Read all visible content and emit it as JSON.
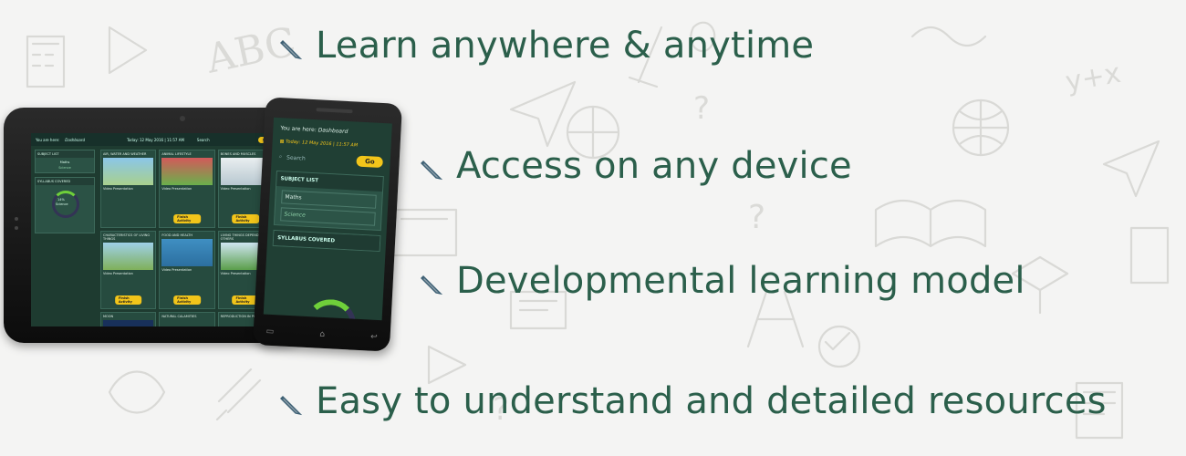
{
  "features": [
    {
      "text": "Learn anywhere & anytime"
    },
    {
      "text": "Access on any device"
    },
    {
      "text": "Developmental learning model"
    },
    {
      "text": "Easy to understand and detailed resources"
    }
  ],
  "colors": {
    "text": "#2b5f4b",
    "background": "#f4f4f3",
    "accent": "#f2c51a",
    "screen": "#1e3b30"
  },
  "icons": {
    "bullet": "pencil-icon"
  },
  "tablet": {
    "breadcrumb_prefix": "You are here:",
    "breadcrumb": "Dashboard",
    "date": "Today: 12 May 2016 | 11:57 AM",
    "search_placeholder": "Search",
    "go_label": "Go",
    "subject_list": "SUBJECT LIST",
    "subjects": [
      "Maths",
      "Science"
    ],
    "syllabus": "SYLLABUS COVERED",
    "progress": "14%",
    "progress_subject": "Science",
    "cards": [
      {
        "title": "AIR, WATER AND WEATHER",
        "label": "Video Presentation",
        "button": "Finish Activity"
      },
      {
        "title": "ANIMAL LIFESTYLE",
        "label": "Video Presentation",
        "button": "Finish Activity"
      },
      {
        "title": "BONES AND MUSCLES",
        "label": "Video Presentation",
        "button": "Finish Activity"
      },
      {
        "title": "CHARACTERISTICS OF LIVING THINGS",
        "label": "Video Presentation",
        "button": "Finish Activity"
      },
      {
        "title": "FOOD AND HEALTH",
        "label": "Video Presentation",
        "button": "Finish Activity"
      },
      {
        "title": "LIVING THINGS DEPEND ON OTHERS",
        "label": "Video Presentation",
        "button": "Finish Activity"
      }
    ],
    "bottom_cards": [
      "MOON",
      "NATURAL CALAMITIES",
      "REPRODUCTION IN PLANTS"
    ]
  },
  "phone": {
    "breadcrumb_prefix": "You are here:",
    "breadcrumb": "Dashboard",
    "date": "Today: 12 May 2016 | 11:57 AM",
    "search_placeholder": "Search",
    "go_label": "Go",
    "subject_list": "SUBJECT LIST",
    "subjects": [
      "Maths",
      "Science"
    ],
    "syllabus": "SYLLABUS COVERED"
  }
}
